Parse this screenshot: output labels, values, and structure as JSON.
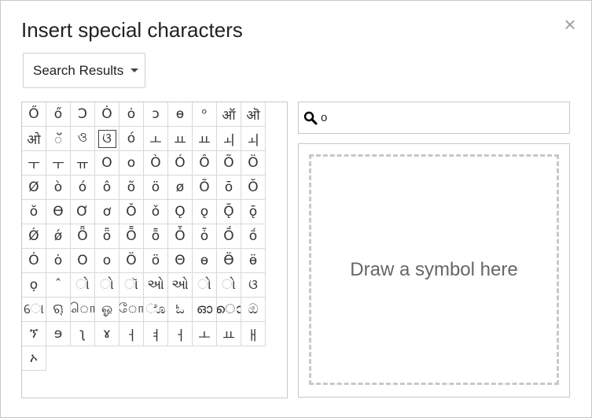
{
  "dialog": {
    "title": "Insert special characters",
    "close_label": "×"
  },
  "category_dropdown": {
    "selected": "Search Results"
  },
  "search": {
    "value": "o"
  },
  "draw": {
    "hint": "Draw a symbol here"
  },
  "selected_char_index": 13,
  "characters": [
    "Ő",
    "ő",
    "Ɔ",
    "Ȯ",
    "ȯ",
    "ɔ",
    "ɵ",
    "ᵒ",
    "ऑ",
    "ऒ",
    "ओ",
    "ॅ",
    "ও",
    "ଓ",
    "ó",
    "ㅗ",
    "ㅛ",
    "ㅛ",
    "ㅚ",
    "ㅚ",
    "ㅜ",
    "ㅜ",
    "ㅠ",
    "O",
    "o",
    "Ò",
    "Ó",
    "Ô",
    "Õ",
    "Ö",
    "Ø",
    "ò",
    "ó",
    "ô",
    "õ",
    "ö",
    "ø",
    "Ō",
    "ō",
    "Ŏ",
    "ŏ",
    "Ɵ",
    "Ơ",
    "ơ",
    "Ǒ",
    "ǒ",
    "Ǫ",
    "ǫ",
    "Ǭ",
    "ǭ",
    "Ǿ",
    "ǿ",
    "Ȫ",
    "ȫ",
    "Ȭ",
    "ȭ",
    "Ȱ",
    "ȱ",
    "Ṍ",
    "ṍ",
    "Ȯ",
    "ȯ",
    "O",
    "o",
    "Ö",
    "ö",
    "Θ",
    "ɵ",
    "Ӫ",
    "ӫ",
    "ọ",
    "ˆ",
    "ો",
    "ો",
    "ૉ",
    "ઓ",
    "ઓ",
    "ો",
    "ો",
    "ଓ",
    "ୋ",
    "ୠ",
    "ொ",
    "ஓ",
    "ோ",
    "ೊ",
    "ಓ",
    "ഓ",
    "ൊ",
    "ඔ",
    "ኘ",
    "ɘ",
    "ʅ",
    "ɤ",
    "ㅓ",
    "ㅕ",
    "ㅓ",
    "ㅗ",
    "ㅛ",
    "ㅐ",
    "ኦ"
  ]
}
